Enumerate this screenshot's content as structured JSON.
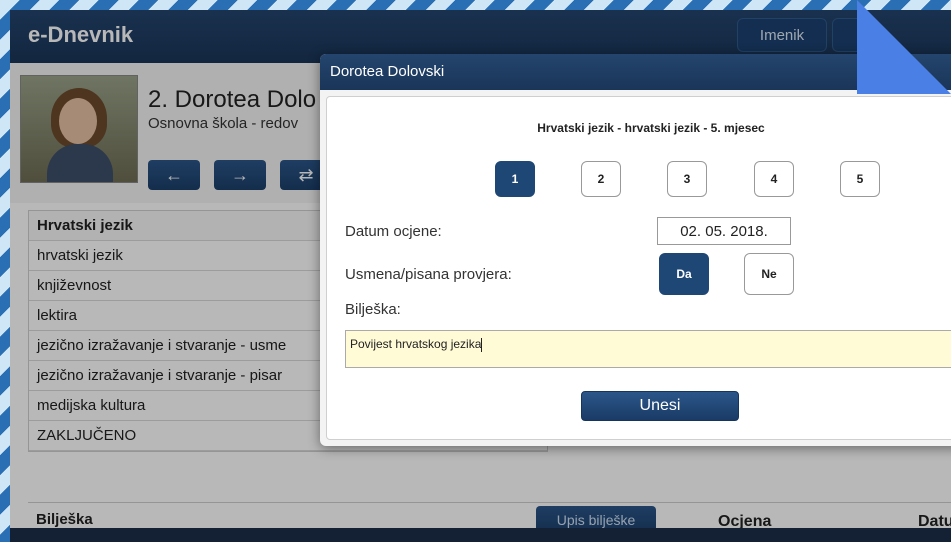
{
  "app": {
    "title": "e-Dnevnik",
    "nav": [
      "Imenik"
    ]
  },
  "student": {
    "name": "2. Dorotea Dolo",
    "school": "Osnovna škola - redov",
    "nav_icons": [
      "arrow-left-icon",
      "arrow-right-icon",
      "shuffle-icon"
    ]
  },
  "subjects": {
    "header": "Hrvatski jezik",
    "rows": [
      "hrvatski jezik",
      "književnost",
      "lektira",
      "jezično izražavanje i stvaranje - usme",
      "jezično izražavanje i stvaranje - pisar",
      "medijska kultura",
      "ZAKLJUČENO"
    ]
  },
  "bottom": {
    "note_label": "Bilješka",
    "note_button": "Upis bilješke",
    "grade_col": "Ocjena",
    "date_col": "Datu"
  },
  "modal": {
    "title": "Dorotea Dolovski",
    "subtitle": "Hrvatski jezik - hrvatski jezik - 5. mjesec",
    "grades": [
      "1",
      "2",
      "3",
      "4",
      "5"
    ],
    "selected_grade": "1",
    "date_label": "Datum ocjene:",
    "date_value": "02. 05. 2018.",
    "check_label": "Usmena/pisana provjera:",
    "yes_label": "Da",
    "no_label": "Ne",
    "note_label": "Bilješka:",
    "note_value": "Povijest hrvatskog jezika",
    "submit_label": "Unesi"
  },
  "colors": {
    "header": "#1a3558",
    "accent": "#1f4775",
    "note_bg": "#fffbd6",
    "corner": "#4a7fe6"
  }
}
